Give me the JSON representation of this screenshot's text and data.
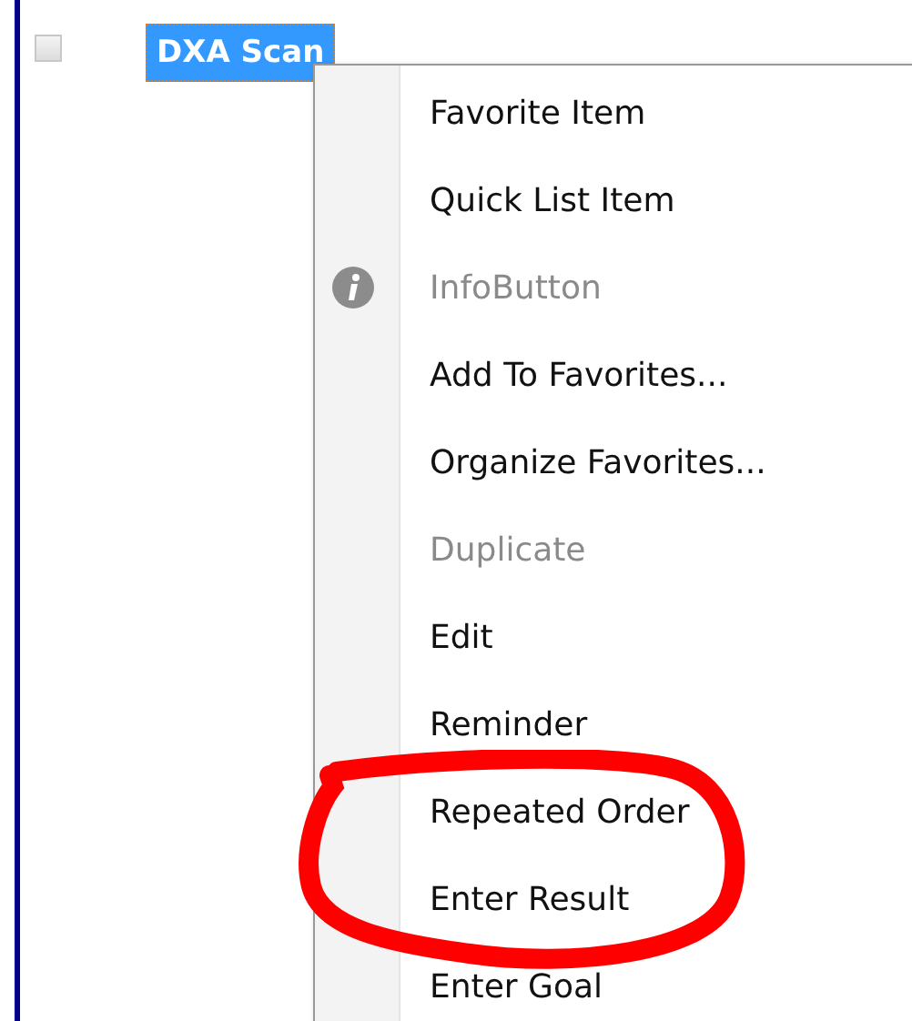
{
  "order_row": {
    "checked": false,
    "label": "DXA Scan",
    "selected": true
  },
  "context_menu": [
    {
      "label": "Favorite Item",
      "kind": "text",
      "disabled": false
    },
    {
      "label": "Quick List Item",
      "kind": "text",
      "disabled": false
    },
    {
      "label": "InfoButton",
      "kind": "info",
      "disabled": true
    },
    {
      "label": "Add To Favorites...",
      "kind": "text",
      "disabled": false
    },
    {
      "label": "Organize Favorites...",
      "kind": "text",
      "disabled": false
    },
    {
      "label": "Duplicate",
      "kind": "text",
      "disabled": true
    },
    {
      "label": "Edit",
      "kind": "text",
      "disabled": false
    },
    {
      "label": "Reminder",
      "kind": "text",
      "disabled": false
    },
    {
      "label": "Repeated Order",
      "kind": "text",
      "disabled": false
    },
    {
      "label": "Enter Result",
      "kind": "text",
      "disabled": false
    },
    {
      "label": "Enter Goal",
      "kind": "text",
      "disabled": false
    }
  ]
}
